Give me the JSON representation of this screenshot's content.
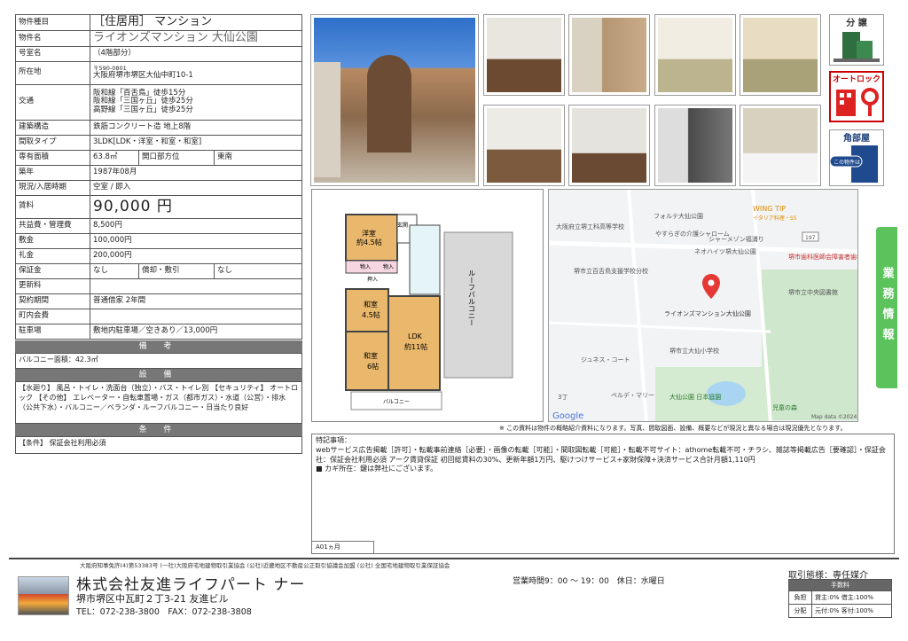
{
  "info": {
    "rows": [
      {
        "h": "物件種目",
        "v": "［住居用］ マンション"
      },
      {
        "h": "物件名",
        "v": "ライオンズマンション 大仙公園"
      },
      {
        "h": "号室名",
        "v": "（4階部分）"
      },
      {
        "h": "所在地",
        "zip": "〒590-0801",
        "v": "大阪府堺市堺区大仙中町10-1"
      },
      {
        "h": "交通",
        "lines": [
          "阪和線「百舌鳥」徒歩15分",
          "阪和線「三国ヶ丘」徒歩25分",
          "高野線「三国ヶ丘」徒歩25分"
        ]
      },
      {
        "h": "建築構造",
        "v": "鉄筋コンクリート造 地上8階"
      },
      {
        "h": "間取タイプ",
        "v": "3LDK[LDK・洋室・和室・和室]"
      },
      {
        "h": "専有面積",
        "v": "63.8㎡",
        "h2": "開口部方位",
        "v2": "東南"
      },
      {
        "h": "築年",
        "v": "1987年08月"
      },
      {
        "h": "現況/入居時期",
        "v": "空室 / 即入"
      },
      {
        "h": "賃料",
        "v": "90,000 円"
      },
      {
        "h": "共益費・管理費",
        "v": "8,500円"
      },
      {
        "h": "敷金",
        "v": "100,000円"
      },
      {
        "h": "礼金",
        "v": "200,000円"
      },
      {
        "h": "保証金",
        "v": "なし",
        "h2": "償却・敷引",
        "v2": "なし"
      },
      {
        "h": "更新料",
        "v": ""
      },
      {
        "h": "契約期間",
        "v": "普通借家 2年間"
      },
      {
        "h": "町内会費",
        "v": ""
      },
      {
        "h": "駐車場",
        "v": "敷地内駐車場／空きあり／13,000円"
      }
    ]
  },
  "remarks": {
    "title": "備 考",
    "text": "バルコニー面積：42.3㎡"
  },
  "equipment": {
    "title": "設 備",
    "text": "【水廻り】 風呂・トイレ・洗面台（独立）・バス・トイレ別 【セキュリティ】 オートロック 【その他】 エレベーター・自転車置場・ガス（都市ガス）・水道（公営）・排水（公共下水）・バルコニー／ベランダ・ルーフバルコニー・日当たり良好"
  },
  "conditions": {
    "title": "条 件",
    "text": "【条件】 保証会社利用必須"
  },
  "badges": {
    "bunjo": "分 譲",
    "autolock": "オートロック",
    "kado": "角部屋",
    "kado_sub": "この物件は"
  },
  "side_tab": "業務情報",
  "floorplan": {
    "rooms": [
      "洋室",
      "約4.5帖",
      "玄関",
      "和室",
      "4.5帖",
      "LDK",
      "約11帖",
      "和室",
      "6帖",
      "押入",
      "物入",
      "物入"
    ],
    "roof": "ルーフバルコニー",
    "balcony": "バルコニー"
  },
  "map": {
    "labels": [
      "大阪府立堺工科高等学校",
      "フォルテ大仙公園",
      "WING TIP",
      "イタリア料理・SS",
      "やすらぎの介護シャローム",
      "シャーメゾン福浦り",
      "ネオハイツ堺大仙公園",
      "堺市歯科医師会障害者歯科診療所",
      "堺市立百舌鳥支援学校分校",
      "堺市立中央図書館",
      "ライオンズマンション大仙公園",
      "堺市立大仙小学校",
      "ジュネス・コート",
      "ベルデ・マリー",
      "大仙公園 日本庭園",
      "児童の森",
      "3丁"
    ],
    "google": "Google",
    "credit": "Map data ©2024",
    "route": "197"
  },
  "disclaimer": "※ この資料は物件の概略紹介資料になります。写真、間取図面、設備、概要などが現況と異なる場合は現況優先となります。",
  "notes": {
    "title": "特記事項：",
    "text": "webサービス広告掲載［許可］・転載事前連絡［必要］・画像の転載［可能］・間取図転載［可能］・転載不可サイト：athome転載不可・チラシ、雑誌等掲載広告［要確認］・保証会社：保証会社利用必須 アーク賃貸保証 初回総賃料の30%、更新年額1万円、駆けつけサービス+家財保障+決済サービス合計月額1,110円",
    "key": "■ カギ所在：鍵は弊社にございます。",
    "code": "A01ヵ月"
  },
  "footer": {
    "license": "大阪府知事免許(4)第53383号 (一社)大阪府宅地建物取引業協会 (公社)近畿地区不動産公正取引協議会加盟 (公社) 全国宅地建物取引業保証協会",
    "company": "株式会社友進ライフパート ナー",
    "address": "堺市堺区中瓦町２丁3-21 友進ビル",
    "tel": "TEL：072-238-3800　FAX：072-238-3808",
    "hours": "営業時間9：00 〜 19：00　休日：水曜日",
    "trade_title": "取引態様：専任媒介",
    "fee_title": "手数料",
    "fee_rows": [
      {
        "h": "負担",
        "v": "貸主:0% 借主:100%"
      },
      {
        "h": "分配",
        "v": "元付:0% 客付:100%"
      }
    ]
  }
}
